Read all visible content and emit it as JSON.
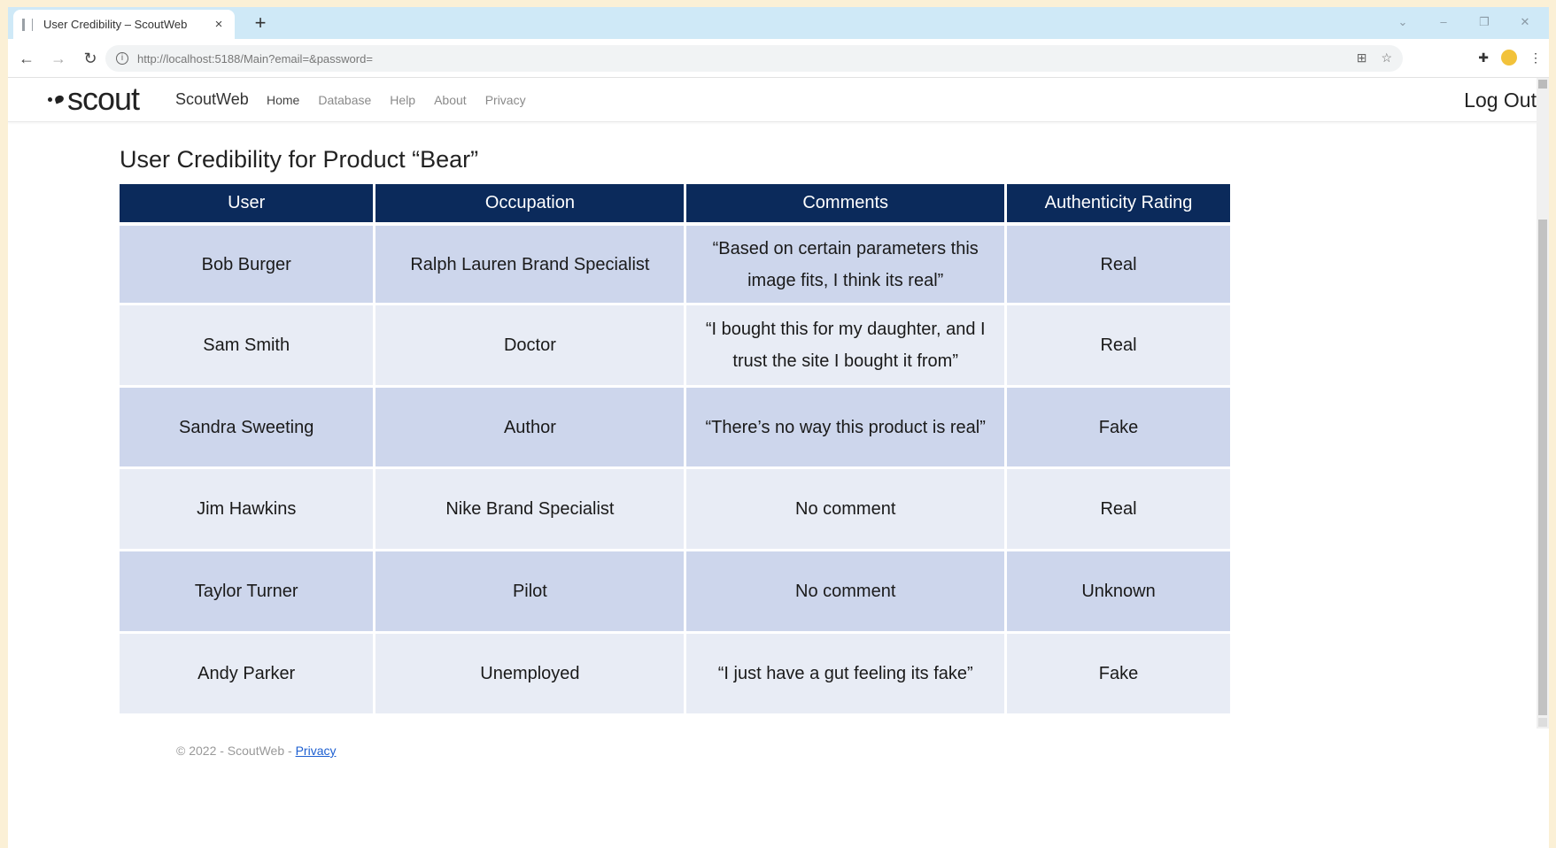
{
  "browser": {
    "tab_title": "User Credibility – ScoutWeb",
    "tab_close": "×",
    "new_tab": "+",
    "url": "http://localhost:5188/Main?email=&password=",
    "window_controls": [
      "⌄",
      "–",
      "❐",
      "✕"
    ]
  },
  "navbar": {
    "logo_text": "scout",
    "brand": "ScoutWeb",
    "links": [
      "Home",
      "Database",
      "Help",
      "About",
      "Privacy"
    ],
    "logout": "Log Out"
  },
  "main": {
    "title": "User Credibility for Product “Bear”",
    "table": {
      "headers": [
        "User",
        "Occupation",
        "Comments",
        "Authenticity Rating"
      ],
      "rows": [
        [
          "Bob Burger",
          "Ralph Lauren Brand Specialist",
          "“Based on certain parameters this image fits, I think its real”",
          "Real"
        ],
        [
          "Sam Smith",
          "Doctor",
          "“I bought this for my daughter, and I trust the site I bought it from”",
          "Real"
        ],
        [
          "Sandra Sweeting",
          "Author",
          "“There’s no way this product is real”",
          "Fake"
        ],
        [
          "Jim Hawkins",
          "Nike Brand Specialist",
          "No comment",
          "Real"
        ],
        [
          "Taylor Turner",
          "Pilot",
          "No comment",
          "Unknown"
        ],
        [
          "Andy Parker",
          "Unemployed",
          "“I just have a gut feeling its fake”",
          "Fake"
        ]
      ]
    }
  },
  "footer": {
    "text": "© 2022 - ScoutWeb - ",
    "privacy_link": "Privacy"
  },
  "colors": {
    "header_bg": "#0b2a5b",
    "row_odd": "#cdd6ec",
    "row_even": "#e8ecf5",
    "tabstrip": "#cfe9f7"
  },
  "icons": [
    "back-icon",
    "forward-icon",
    "reload-icon",
    "info-icon",
    "install-icon",
    "star-icon",
    "extensions-icon",
    "profile-icon",
    "menu-icon"
  ]
}
